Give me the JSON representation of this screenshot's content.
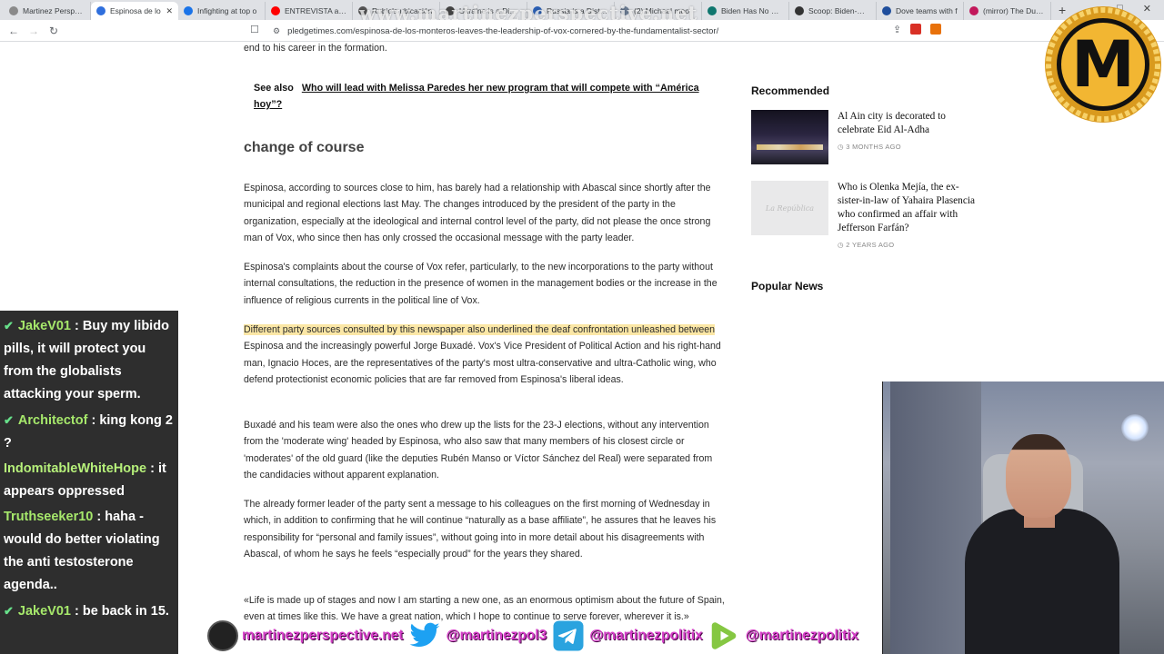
{
  "browser": {
    "tabs": [
      {
        "label": "Martinez Perspecti",
        "color": "#8a8a8a"
      },
      {
        "label": "Espinosa de lo",
        "color": "#2f6fdd",
        "active": true
      },
      {
        "label": "Infighting at top o",
        "color": "#1a73e8"
      },
      {
        "label": "ENTREVISTA a SA",
        "color": "#ff0000"
      },
      {
        "label": "Rubio's ubicación",
        "color": "#555555"
      },
      {
        "label": "Ukraine is a Distinc",
        "color": "#444444"
      },
      {
        "label": "Russia is a Distinc",
        "color": "#2b5fb4"
      },
      {
        "label": "(2) Michael moo",
        "color": "#6b7c93"
      },
      {
        "label": "Biden Has No Mis",
        "color": "#0f766e"
      },
      {
        "label": "Scoop: Biden-Neta",
        "color": "#333333"
      },
      {
        "label": "Dove teams with f",
        "color": "#1f4e9c"
      },
      {
        "label": "(mirror) The Dums",
        "color": "#c2185b"
      }
    ],
    "new_tab": "+",
    "window_controls": [
      "–",
      "□",
      "✕"
    ],
    "url": "pledgetimes.com/espinosa-de-los-monteros-leaves-the-leadership-of-vox-cornered-by-the-fundamentalist-sector/",
    "watermark": "www.martinezperspective.net"
  },
  "article": {
    "top_fragment": "end to his career in the formation.",
    "see_also_label": "See also",
    "see_also_link": "Who will lead with Melissa Paredes her new program that will compete with “América hoy”?",
    "heading": "change of course",
    "p1": "Espinosa, according to sources close to him, has barely had a relationship with Abascal since shortly after the municipal and regional elections last May. The changes introduced by the president of the party in the organization, especially at the ideological and internal control level of the party, did not please the once strong man of Vox, who since then has only crossed the occasional message with the party leader.",
    "p2": "Espinosa's complaints about the course of Vox refer, particularly, to the new incorporations to the party without internal consultations, the reduction in the presence of women in the management bodies or the increase in the influence of religious currents in the political line of Vox.",
    "p3_highlight": "Different party sources consulted by this newspaper also underlined the deaf confrontation unleashed between",
    "p3_rest": " Espinosa and the increasingly powerful Jorge Buxadé. Vox's Vice President of Political Action and his right-hand man, Ignacio Hoces, are the representatives of the party's most ultra-conservative and ultra-Catholic wing, who defend protectionist economic policies that are far removed from Espinosa's liberal ideas.",
    "p4": "Buxadé and his team were also the ones who drew up the lists for the 23-J elections, without any intervention from the 'moderate wing' headed by Espinosa, who also saw that many members of his closest circle or 'moderates' of the old guard (like the deputies Rubén Manso or Víctor Sánchez del Real) were separated from the candidacies without apparent explanation.",
    "p5": "The already former leader of the party sent a message to his colleagues on the first morning of Wednesday in which, in addition to confirming that he will continue “naturally as a base affiliate”, he assures that he leaves his responsibility for “personal and family issues”, without going into in more detail about his disagreements with Abascal, of whom he says he feels “especially proud” for the years they shared.",
    "p6": "«Life is made up of stages and now I am starting a new one, as an enormous optimism about the future of Spain, even at times like this. We have a great nation, which I hope to continue to serve forever, wherever it is.»"
  },
  "sidebar": {
    "recommended_heading": "Recommended",
    "items": [
      {
        "title": "Al Ain city is decorated to celebrate Eid Al-Adha",
        "meta": "3 MONTHS AGO"
      },
      {
        "title": "Who is Olenka Mejía, the ex-sister-in-law of Yahaira Plasencia who confirmed an affair with Jefferson Farfán?",
        "meta": "2 YEARS AGO",
        "thumb_text": "La República"
      }
    ],
    "popular_heading": "Popular News"
  },
  "chat": [
    {
      "user": "JakeV01",
      "text": "Buy my libido pills, it will protect you from the globalists attacking your sperm.",
      "badge": true
    },
    {
      "user": "Architectof",
      "text": "king kong 2 ?",
      "badge": true
    },
    {
      "user": "IndomitableWhiteHope",
      "text": "it appears oppressed",
      "badge": false
    },
    {
      "user": "Truthseeker10",
      "text": "haha - would do better violating the anti testosterone agenda..",
      "badge": false
    },
    {
      "user": "JakeV01",
      "text": "be back in 15.",
      "badge": true
    }
  ],
  "logo": {
    "letter": "M",
    "colors": {
      "gold": "#f2b632",
      "black": "#111111"
    }
  },
  "banner": {
    "site": "martinezperspective.net",
    "twitter": "@martinezpol3",
    "telegram": "@martinezpolitix",
    "rumble": "@martinezpolitix",
    "colors": {
      "text": "#d63ec9",
      "twitter": "#1da1f2",
      "telegram": "#2aa3df",
      "rumble": "#85c742"
    }
  }
}
